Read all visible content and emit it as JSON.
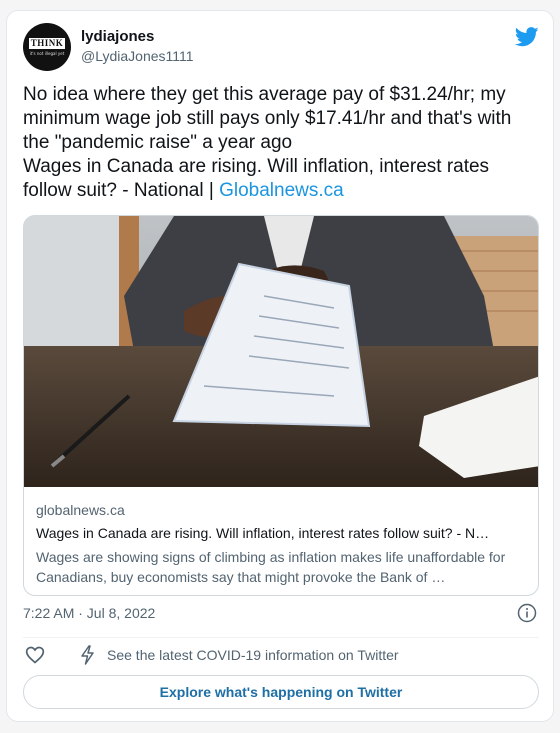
{
  "user": {
    "name": "lydiajones",
    "handle": "@LydiaJones1111",
    "avatar_logo": "THINK",
    "avatar_tagline": "it's not illegal yet"
  },
  "tweet": {
    "text": "No idea where they get this average pay of $31.24/hr; my minimum wage job still pays only $17.41/hr and that's with the \"pandemic raise\" a year ago",
    "headline": "Wages in Canada are rising. Will inflation, interest rates follow suit? - National | ",
    "link_text": "Globalnews.ca",
    "timestamp": "7:22 AM · Jul 8, 2022"
  },
  "card": {
    "domain": "globalnews.ca",
    "title": "Wages in Canada are rising. Will inflation, interest rates follow suit? - N…",
    "description": "Wages are showing signs of climbing as inflation makes life unaffordable for Canadians, buy economists say that might provoke the Bank of …"
  },
  "actions": {
    "covid_text": "See the latest COVID-19 information on Twitter",
    "explore_label": "Explore what's happening on Twitter"
  },
  "colors": {
    "link": "#1b95e0",
    "twitter_blue": "#1d9bf0",
    "secondary_text": "#536471"
  },
  "icons": [
    "twitter-bird-icon",
    "info-icon",
    "heart-icon",
    "bolt-icon"
  ]
}
